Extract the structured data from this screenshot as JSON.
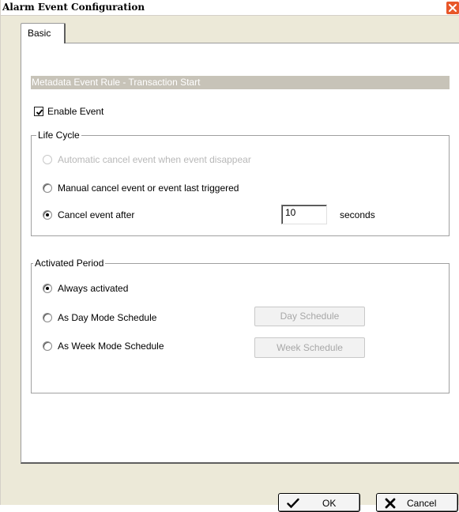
{
  "window": {
    "title": "Alarm Event Configuration"
  },
  "tabs": [
    {
      "label": "Basic",
      "selected": true
    }
  ],
  "rule_header": "Metadata Event Rule - Transaction Start",
  "enable_event": {
    "label": "Enable Event",
    "checked": true
  },
  "life_cycle": {
    "title": "Life Cycle",
    "options": [
      {
        "label": "Automatic cancel event when event disappear",
        "selected": false,
        "disabled": true
      },
      {
        "label": "Manual cancel event or event last triggered",
        "selected": false,
        "disabled": false
      },
      {
        "label": "Cancel event after",
        "selected": true,
        "disabled": false
      }
    ],
    "cancel_after_value": "10",
    "cancel_after_unit": "seconds"
  },
  "activated_period": {
    "title": "Activated Period",
    "options": [
      {
        "label": "Always activated",
        "selected": true
      },
      {
        "label": "As Day Mode Schedule",
        "selected": false
      },
      {
        "label": "As Week Mode Schedule",
        "selected": false
      }
    ],
    "day_schedule_button": "Day Schedule",
    "week_schedule_button": "Week Schedule"
  },
  "footer": {
    "ok_label": "OK",
    "cancel_label": "Cancel"
  },
  "colors": {
    "header_bar": "#c7c3b8",
    "close_button": "#e8572a",
    "dialog_background": "#ece9d8"
  },
  "icons": {
    "close": "close-icon",
    "ok": "checkmark-icon",
    "cancel": "x-icon"
  }
}
